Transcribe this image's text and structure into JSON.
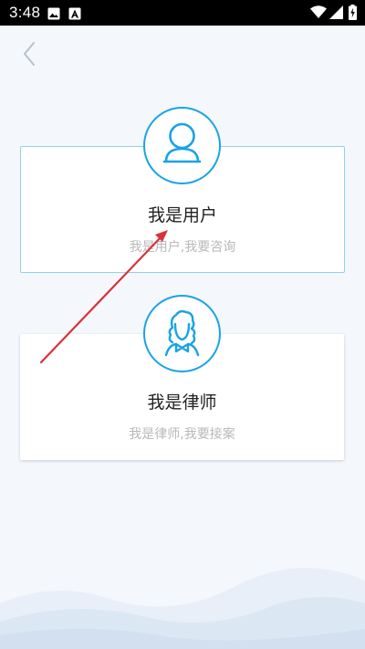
{
  "status_bar": {
    "time": "3:48",
    "icons": [
      "image-icon",
      "a-notification-icon",
      "wifi-icon",
      "signal-icon",
      "battery-charging-icon"
    ]
  },
  "navigation": {
    "back_icon": "chevron-left-icon"
  },
  "cards": [
    {
      "id": "user",
      "title": "我是用户",
      "subtitle": "我是用户,我要咨询",
      "icon": "user-avatar-icon"
    },
    {
      "id": "lawyer",
      "title": "我是律师",
      "subtitle": "我是律师,我要接案",
      "icon": "lawyer-avatar-icon"
    }
  ],
  "colors": {
    "accent": "#1aa3e6",
    "selected_border": "#8fd3ee",
    "annotation": "#d9323a",
    "background": "#f4f7fb"
  }
}
